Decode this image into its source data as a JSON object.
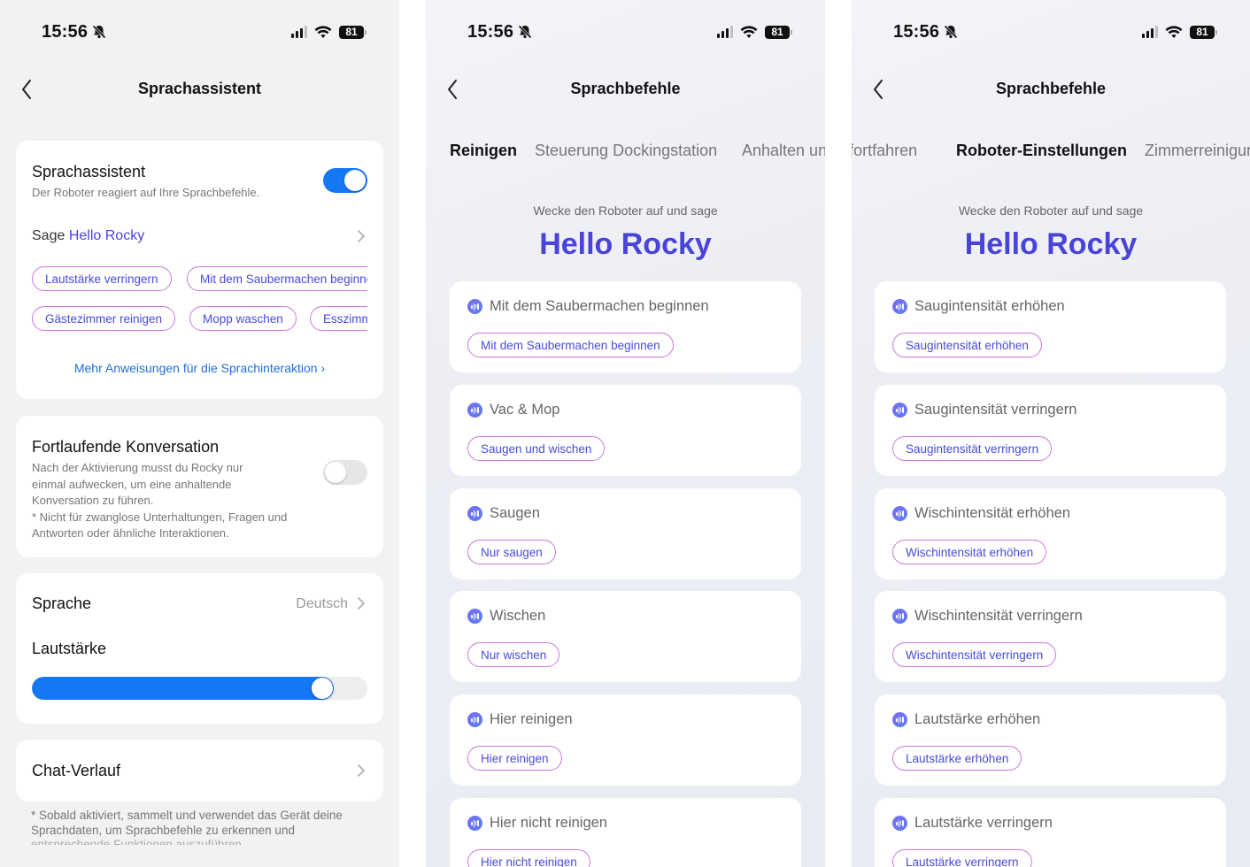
{
  "status": {
    "time": "15:56",
    "battery": "81"
  },
  "screen1": {
    "title": "Sprachassistent",
    "assistant": {
      "title": "Sprachassistent",
      "subtitle": "Der Roboter reagiert auf Ihre Sprachbefehle.",
      "enabled": true,
      "say_prefix": "Sage",
      "wake_word": "Hello Rocky",
      "chips_row1": [
        "Lautstärke verringern",
        "Mit dem Saubermachen beginnen"
      ],
      "chips_row2": [
        "Gästezimmer reinigen",
        "Mopp waschen",
        "Esszimmer"
      ],
      "more_link": "Mehr Anweisungen für die Sprachinteraktion"
    },
    "conversation": {
      "title": "Fortlaufende Konversation",
      "line1": "Nach der Aktivierung musst du Rocky nur",
      "line2": "einmal aufwecken, um eine anhaltende",
      "line3": "Konversation zu führen.",
      "line4": "* Nicht für zwanglose Unterhaltungen, Fragen und",
      "line5": "Antworten oder ähnliche Interaktionen.",
      "enabled": false
    },
    "language": {
      "label": "Sprache",
      "value": "Deutsch"
    },
    "volume": {
      "label": "Lautstärke",
      "level": 0.9
    },
    "chat_history": {
      "label": "Chat-Verlauf"
    },
    "footer": {
      "line1": "* Sobald aktiviert, sammelt und verwendet das Gerät deine",
      "line2": "Sprachdaten, um Sprachbefehle zu erkennen und"
    }
  },
  "screen2": {
    "title": "Sprachbefehle",
    "tabs": [
      "Reinigen",
      "Steuerung Dockingstation",
      "Anhalten und fortfahren"
    ],
    "active_tab": "Reinigen",
    "wake_text": "Wecke den Roboter auf und sage",
    "wake_word": "Hello Rocky",
    "commands": [
      {
        "title": "Mit dem Saubermachen beginnen",
        "example": "Mit dem Saubermachen beginnen"
      },
      {
        "title": "Vac & Mop",
        "example": "Saugen und wischen"
      },
      {
        "title": "Saugen",
        "example": "Nur saugen"
      },
      {
        "title": "Wischen",
        "example": "Nur wischen"
      },
      {
        "title": "Hier reinigen",
        "example": "Hier reinigen"
      },
      {
        "title": "Hier nicht reinigen",
        "example": "Hier nicht reinigen"
      }
    ]
  },
  "screen3": {
    "title": "Sprachbefehle",
    "tabs": [
      "Anhalten und fortfahren",
      "Roboter-Einstellungen",
      "Zimmerreinigung"
    ],
    "active_tab": "Roboter-Einstellungen",
    "wake_text": "Wecke den Roboter auf und sage",
    "wake_word": "Hello Rocky",
    "commands": [
      {
        "title": "Saugintensität erhöhen",
        "example": "Saugintensität erhöhen"
      },
      {
        "title": "Saugintensität verringern",
        "example": "Saugintensität verringern"
      },
      {
        "title": "Wischintensität erhöhen",
        "example": "Wischintensität erhöhen"
      },
      {
        "title": "Wischintensität verringern",
        "example": "Wischintensität verringern"
      },
      {
        "title": "Lautstärke erhöhen",
        "example": "Lautstärke erhöhen"
      },
      {
        "title": "Lautstärke verringern",
        "example": "Lautstärke verringern"
      }
    ]
  },
  "colors": {
    "accent": "#1677f2",
    "brand_text": "#4a43d9",
    "chip_border": "#c77ad9"
  }
}
